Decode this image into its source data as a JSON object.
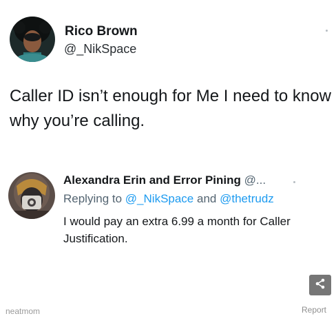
{
  "tweet": {
    "author_name": "Rico Brown",
    "author_handle": "@_NikSpace",
    "text": "Caller ID isn’t enough for Me I need to know why you’re calling."
  },
  "reply": {
    "author_name": "Alexandra Erin and Error Pining",
    "author_handle": "@...",
    "replying_prefix": "Replying to",
    "replying_mention_1": "@_NikSpace",
    "replying_and": "and",
    "replying_mention_2": "@thetrudz",
    "text": "I would pay an extra 6.99 a month for Caller Justification."
  },
  "footer": {
    "watermark": "neatmom",
    "report_label": "Report"
  },
  "icons": {
    "share": "share-icon",
    "more": "more-dot-icon"
  },
  "colors": {
    "text": "#14171a",
    "secondary": "#536471",
    "mention": "#1d9bf0",
    "share_button": "#767676"
  }
}
